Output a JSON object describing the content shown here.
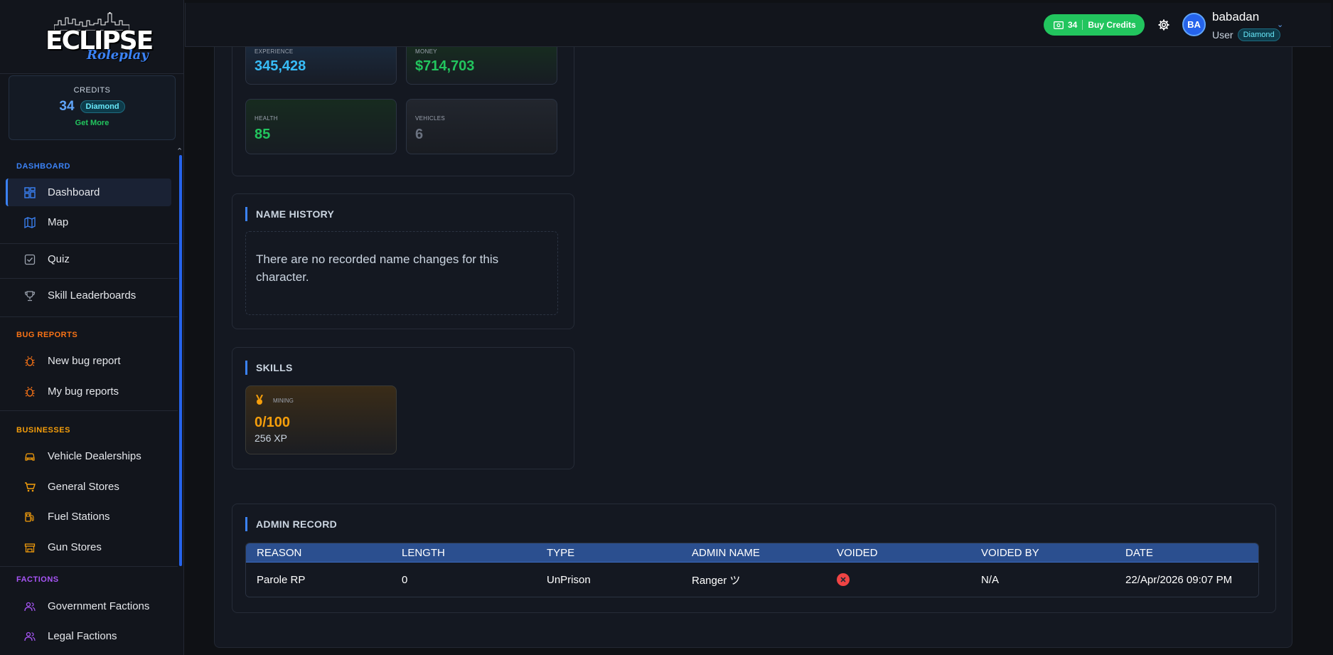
{
  "brand": {
    "logo_main": "ECLIPSE",
    "logo_sub": "Roleplay"
  },
  "credits_card": {
    "label": "CREDITS",
    "amount": "34",
    "tier": "Diamond",
    "more": "Get More"
  },
  "nav": {
    "sections": [
      {
        "title": "DASHBOARD",
        "color": "#3b82f6"
      },
      {
        "title": "BUG REPORTS",
        "color": "#f97316"
      },
      {
        "title": "BUSINESSES",
        "color": "#f59e0b"
      },
      {
        "title": "FACTIONS",
        "color": "#a855f7"
      }
    ],
    "items": [
      {
        "label": "Dashboard",
        "icon": "dashboard-grid-icon"
      },
      {
        "label": "Map",
        "icon": "map-icon"
      },
      {
        "label": "Quiz",
        "icon": "quiz-checkbox-icon"
      },
      {
        "label": "Skill Leaderboards",
        "icon": "trophy-icon"
      },
      {
        "label": "New bug report",
        "icon": "bug-icon"
      },
      {
        "label": "My bug reports",
        "icon": "bug-icon"
      },
      {
        "label": "Vehicle Dealerships",
        "icon": "car-icon"
      },
      {
        "label": "General Stores",
        "icon": "cart-icon"
      },
      {
        "label": "Fuel Stations",
        "icon": "fuel-icon"
      },
      {
        "label": "Gun Stores",
        "icon": "store-icon"
      },
      {
        "label": "Government Factions",
        "icon": "users-icon"
      },
      {
        "label": "Legal Factions",
        "icon": "users-icon"
      }
    ]
  },
  "topbar": {
    "credits": "34",
    "buy_label": "Buy Credits",
    "avatar_initials": "BA",
    "username": "babadan",
    "role": "User",
    "tier": "Diamond"
  },
  "stats": [
    {
      "label": "EXPERIENCE",
      "value": "345,428",
      "color": "#38bdf8"
    },
    {
      "label": "MONEY",
      "value": "$714,703",
      "color": "#22c55e"
    },
    {
      "label": "HEALTH",
      "value": "85",
      "color": "#22c55e"
    },
    {
      "label": "VEHICLES",
      "value": "6",
      "color": "#6b7280"
    }
  ],
  "name_history": {
    "title": "NAME HISTORY",
    "empty": "There are no recorded name changes for this character."
  },
  "skills": {
    "title": "SKILLS",
    "items": [
      {
        "name": "MINING",
        "level": "0/100",
        "xp": "256 XP",
        "color": "#f59e0b"
      }
    ]
  },
  "admin_record": {
    "title": "ADMIN RECORD",
    "columns": [
      "REASON",
      "LENGTH",
      "TYPE",
      "ADMIN NAME",
      "VOIDED",
      "VOIDED BY",
      "DATE"
    ],
    "rows": [
      {
        "reason": "Parole RP",
        "length": "0",
        "type": "UnPrison",
        "admin": "Ranger ツ",
        "voided_icon": "x-circle-icon",
        "voided_by": "N/A",
        "date": "22/Apr/2026 09:07 PM"
      }
    ]
  }
}
